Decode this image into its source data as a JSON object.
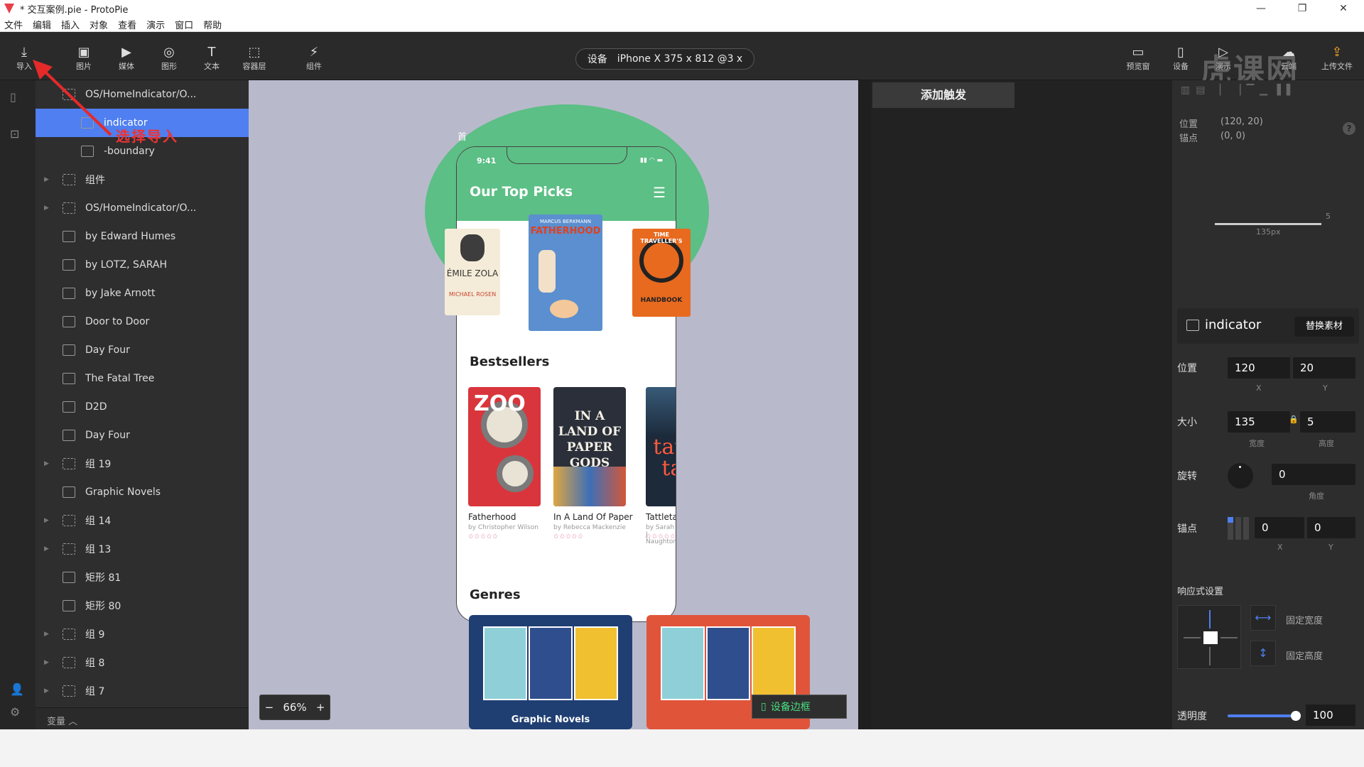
{
  "window": {
    "title": "* 交互案例.pie - ProtoPie",
    "controls": [
      "—",
      "❐",
      "✕"
    ]
  },
  "menu": [
    "文件",
    "编辑",
    "插入",
    "对象",
    "查看",
    "演示",
    "窗口",
    "帮助"
  ],
  "toolbar": {
    "left": [
      {
        "label": "导入",
        "icon": "download-icon",
        "glyph": "⤓"
      },
      {
        "label": "图片",
        "icon": "image-icon",
        "glyph": "▣"
      },
      {
        "label": "媒体",
        "icon": "media-icon",
        "glyph": "▶"
      },
      {
        "label": "图形",
        "icon": "shape-icon",
        "glyph": "◎"
      },
      {
        "label": "文本",
        "icon": "text-icon",
        "glyph": "T"
      },
      {
        "label": "容器层",
        "icon": "container-icon",
        "glyph": "⬚"
      },
      {
        "label": "组件",
        "icon": "component-icon",
        "glyph": "⚡"
      }
    ],
    "device": {
      "prefix": "设备",
      "value": "iPhone X  375 x 812  @3 x"
    },
    "right": [
      {
        "label": "预览窗",
        "icon": "preview-icon",
        "glyph": "▭"
      },
      {
        "label": "设备",
        "icon": "device-icon",
        "glyph": "▯"
      },
      {
        "label": "演示",
        "icon": "play-icon",
        "glyph": "▷"
      },
      {
        "label": "云端",
        "icon": "cloud-icon",
        "glyph": "☁"
      },
      {
        "label": "上传文件",
        "icon": "upload-icon",
        "glyph": "⇪"
      }
    ]
  },
  "annotation": "选择导入",
  "layers": [
    {
      "label": "OS/HomeIndicator/O...",
      "type": "group",
      "indent": 0,
      "arrow": false
    },
    {
      "label": "indicator",
      "type": "image",
      "indent": 1,
      "arrow": false,
      "selected": true
    },
    {
      "label": "-boundary",
      "type": "image",
      "indent": 1,
      "arrow": false
    },
    {
      "label": "组件",
      "type": "group",
      "indent": 0,
      "arrow": true
    },
    {
      "label": "OS/HomeIndicator/O...",
      "type": "group",
      "indent": 0,
      "arrow": true
    },
    {
      "label": "by Edward Humes",
      "type": "text",
      "indent": 0,
      "arrow": false
    },
    {
      "label": "by LOTZ, SARAH",
      "type": "text",
      "indent": 0,
      "arrow": false
    },
    {
      "label": "by Jake Arnott",
      "type": "text",
      "indent": 0,
      "arrow": false
    },
    {
      "label": "Door to Door",
      "type": "text",
      "indent": 0,
      "arrow": false
    },
    {
      "label": "Day Four",
      "type": "text",
      "indent": 0,
      "arrow": false
    },
    {
      "label": "The Fatal Tree",
      "type": "text",
      "indent": 0,
      "arrow": false
    },
    {
      "label": "D2D",
      "type": "image",
      "indent": 0,
      "arrow": false
    },
    {
      "label": "Day Four",
      "type": "image",
      "indent": 0,
      "arrow": false
    },
    {
      "label": "组 19",
      "type": "group",
      "indent": 0,
      "arrow": true
    },
    {
      "label": "Graphic Novels",
      "type": "text",
      "indent": 0,
      "arrow": false
    },
    {
      "label": "组 14",
      "type": "group",
      "indent": 0,
      "arrow": true
    },
    {
      "label": "组 13",
      "type": "group",
      "indent": 0,
      "arrow": true
    },
    {
      "label": "矩形 81",
      "type": "image",
      "indent": 0,
      "arrow": false
    },
    {
      "label": "矩形 80",
      "type": "image",
      "indent": 0,
      "arrow": false
    },
    {
      "label": "组 9",
      "type": "group",
      "indent": 0,
      "arrow": true
    },
    {
      "label": "组 8",
      "type": "group",
      "indent": 0,
      "arrow": true
    },
    {
      "label": "组 7",
      "type": "group",
      "indent": 0,
      "arrow": true
    }
  ],
  "variables_label": "变量 ︿",
  "canvas": {
    "zoom": "66%",
    "zoom_minus": "−",
    "zoom_plus": "+",
    "device_frame": "设备边框",
    "scene_label": "首"
  },
  "phone": {
    "time": "9:41",
    "status": "▮▮ ◠ ▬",
    "title": "Our Top Picks",
    "menu_icon": "☰",
    "top_picks": [
      {
        "cover_text": "ÉMILE ZOLA",
        "cover_sub": "MICHAEL ROSEN",
        "color": "#f4ecd8"
      },
      {
        "cover_text": "FATHERHOOD",
        "cover_sub": "MARCUS BERKMANN",
        "color": "#5b8fcf"
      },
      {
        "cover_text": "TIME TRAVELLER'S",
        "cover_sub": "HANDBOOK",
        "color": "#e86a1f"
      }
    ],
    "bestsellers_title": "Bestsellers",
    "books": [
      {
        "title": "Fatherhood",
        "author": "by Christopher Wilson",
        "cover": "ZOO",
        "color": "#d9353c"
      },
      {
        "title": "In A Land Of Paper",
        "author": "by Rebecca Mackenzie",
        "cover": "IN A LAND OF PAPER GODS",
        "color": "#2a2f3a"
      },
      {
        "title": "Tattletale",
        "author": "by Sarah J Naughton",
        "cover": "tattle tale",
        "color": "#1c2a3a"
      }
    ],
    "stars": "✩✩✩✩✩",
    "genres_title": "Genres",
    "genres": [
      {
        "caption": "Graphic Novels",
        "color": "#1f3f73"
      },
      {
        "caption": "",
        "color": "#e0553a"
      }
    ]
  },
  "triggers": {
    "add_trigger": "添加触发"
  },
  "properties": {
    "pos_label": "位置",
    "pos_value": "(120, 20)",
    "anchor_label": "锚点",
    "anchor_value": "(0, 0)",
    "help": "?",
    "ruler_w": "135px",
    "ruler_h": "5",
    "component_name": "indicator",
    "replace": "替换素材",
    "position": {
      "label": "位置",
      "x": "120",
      "y": "20",
      "x_sub": "X",
      "y_sub": "Y"
    },
    "size": {
      "label": "大小",
      "w": "135",
      "h": "5",
      "w_sub": "宽度",
      "h_sub": "高度",
      "lock": "🔒"
    },
    "rotation": {
      "label": "旋转",
      "value": "0",
      "sub": "角度"
    },
    "anchor": {
      "label": "锚点",
      "x": "0",
      "y": "0",
      "x_sub": "X",
      "y_sub": "Y"
    },
    "responsive": {
      "label": "响应式设置",
      "fixed_width": "固定宽度",
      "fixed_height": "固定高度"
    },
    "opacity": {
      "label": "透明度",
      "value": "100",
      "level": 1.0
    }
  },
  "watermark": "虎课网",
  "colors": {
    "accent": "#4f7ff0",
    "phone_green": "#5cbf85",
    "canvas": "#b9b9cc"
  }
}
